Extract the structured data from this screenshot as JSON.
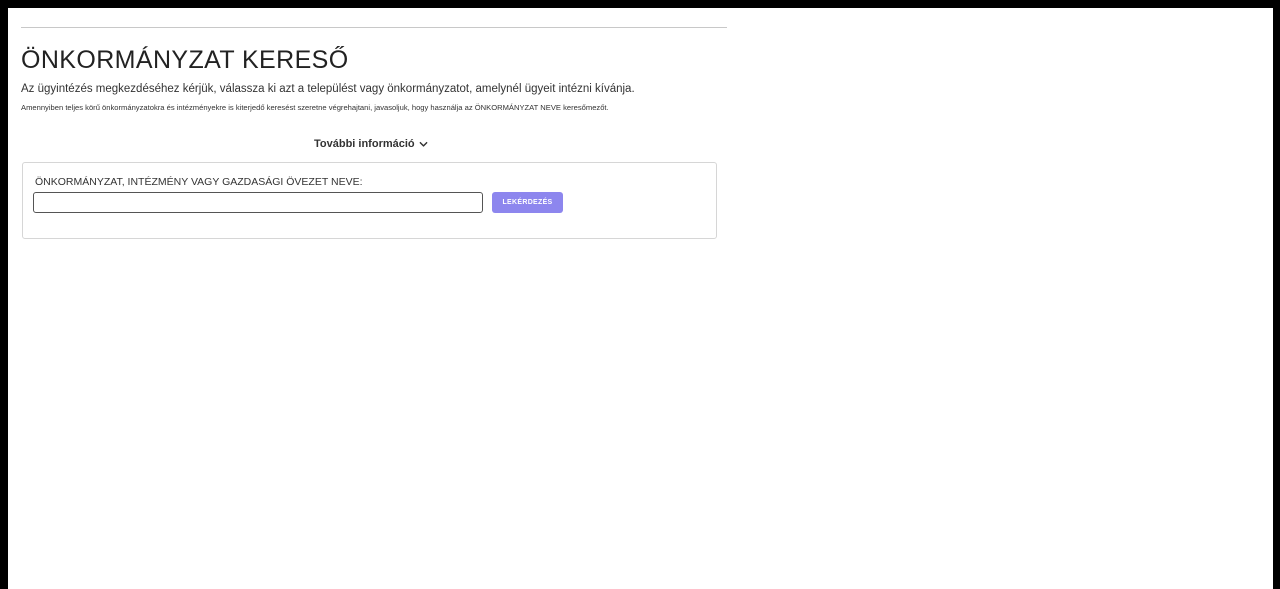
{
  "page": {
    "title": "ÖNKORMÁNYZAT KERESŐ",
    "intro": "Az ügyintézés megkezdéséhez kérjük, válassza ki azt a települést vagy önkormányzatot, amelynél ügyeit intézni kívánja.",
    "note": "Amennyiben teljes körű önkormányzatokra és intézményekre is kiterjedő keresést szeretne végrehajtani, javasoljuk, hogy használja az ÖNKORMÁNYZAT NEVE keresőmezőt.",
    "more_info": "További információ"
  },
  "search": {
    "label": "ÖNKORMÁNYZAT, INTÉZMÉNY VAGY GAZDASÁGI ÖVEZET NEVE:",
    "value": "",
    "button_label": "LEKÉRDEZÉS"
  },
  "colors": {
    "button": "#8d86ee",
    "page_background": "#ffffff",
    "frame": "#000000"
  },
  "icons": {
    "more_info": "chevron-down-icon"
  }
}
